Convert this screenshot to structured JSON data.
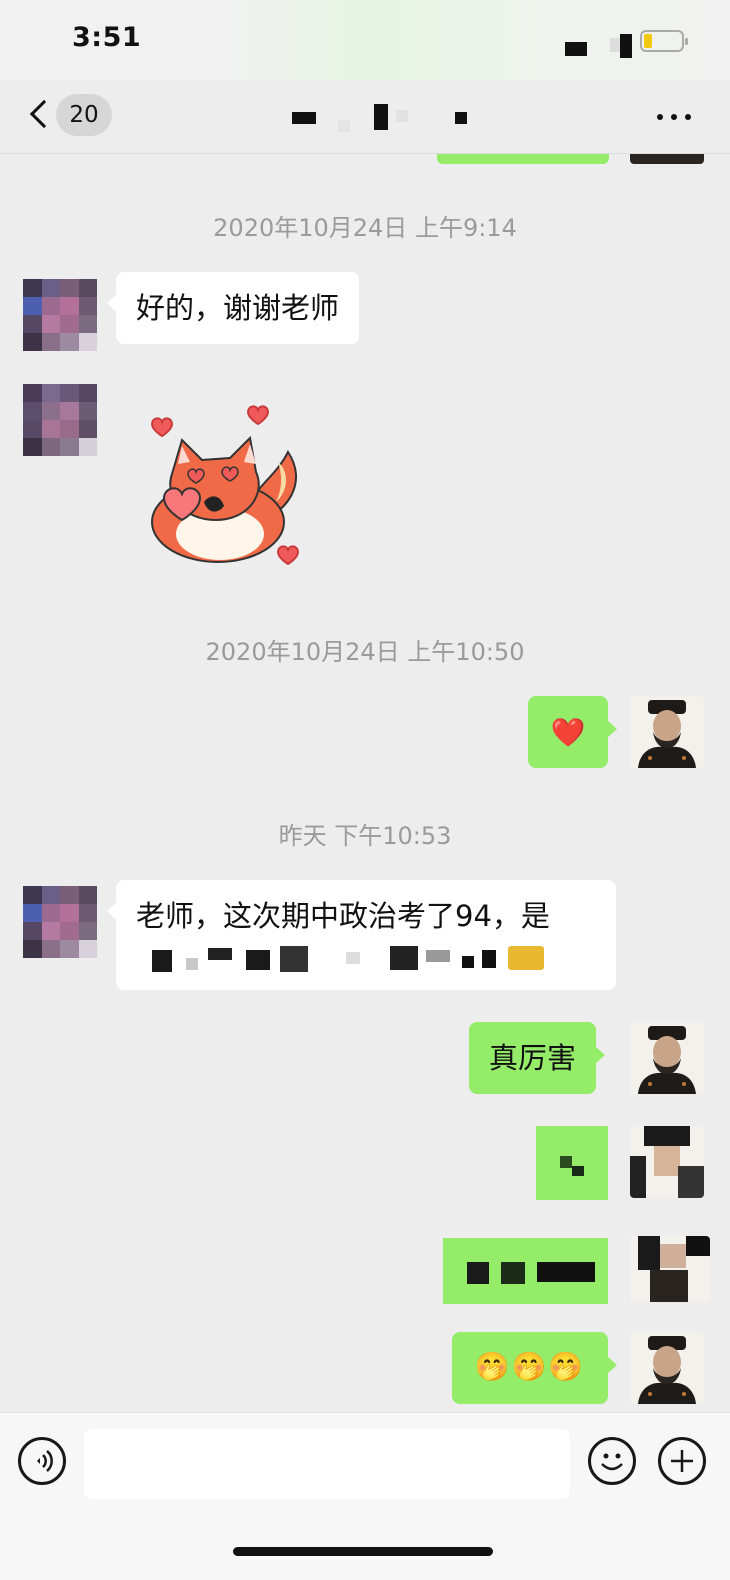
{
  "status_bar": {
    "time": "3:51"
  },
  "nav": {
    "unread_count": "20"
  },
  "messages": {
    "ts1": "2020年10月24日 上午9:14",
    "msg1": "好的，谢谢老师",
    "ts2": "2020年10月24日 上午10:50",
    "msg2_emoji": "❤️",
    "ts3": "昨天 下午10:53",
    "msg3_line1": "老师，这次期中政治考了94，是",
    "msg4": "真厉害",
    "msg7_emoji": "🤭🤭🤭"
  },
  "icons": {
    "back": "chevron-left-icon",
    "more": "more-dots-icon",
    "voice": "voice-icon",
    "emoji": "emoji-face-icon",
    "add": "plus-icon"
  },
  "colors": {
    "background": "#ededed",
    "sent_bubble": "#95ec69",
    "received_bubble": "#ffffff",
    "timestamp_text": "#9a9a9a"
  }
}
